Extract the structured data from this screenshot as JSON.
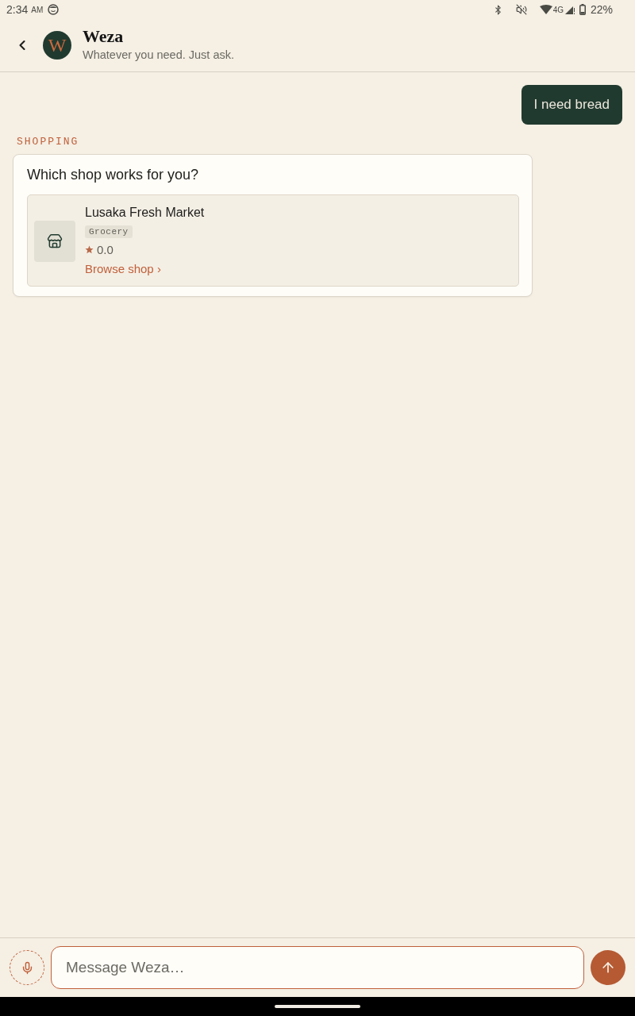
{
  "status_bar": {
    "time": "2:34",
    "meridiem": "AM",
    "network": "4G",
    "battery": "22%"
  },
  "header": {
    "avatar_letter": "W",
    "title": "Weza",
    "subtitle": "Whatever you need. Just ask."
  },
  "messages": [
    {
      "kind": "user",
      "text": "I need bread"
    },
    {
      "kind": "assistant",
      "section": "SHOPPING",
      "question": "Which shop works for you?",
      "shops": [
        {
          "name": "Lusaka Fresh Market",
          "tag": "Grocery",
          "rating": "0.0",
          "action": "Browse shop ›"
        }
      ]
    }
  ],
  "composer": {
    "placeholder": "Message Weza…"
  }
}
